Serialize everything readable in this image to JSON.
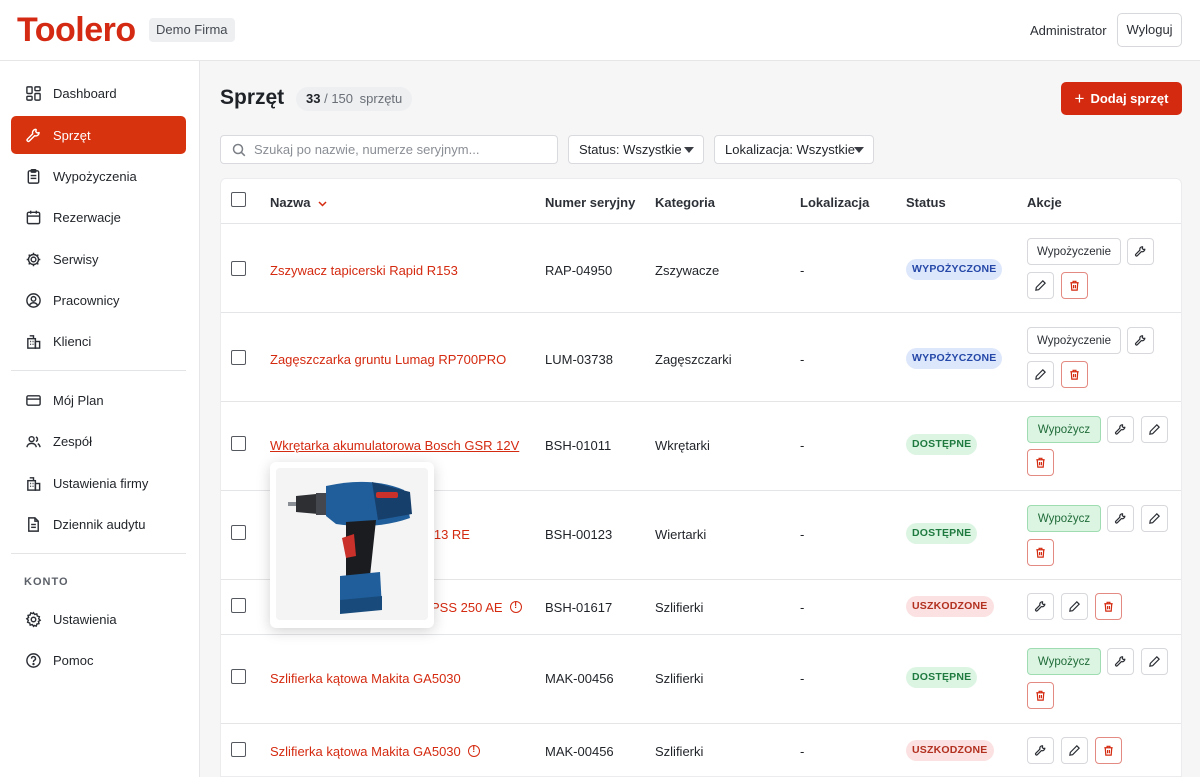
{
  "app": {
    "logo": "Toolero",
    "company": "Demo Firma",
    "user": "Administrator",
    "logout_label": "Wyloguj"
  },
  "sidebar": {
    "items": [
      {
        "label": "Dashboard",
        "icon": "dashboard-icon"
      },
      {
        "label": "Sprzęt",
        "icon": "wrench-icon",
        "active": true
      },
      {
        "label": "Wypożyczenia",
        "icon": "clipboard-icon"
      },
      {
        "label": "Rezerwacje",
        "icon": "calendar-icon"
      },
      {
        "label": "Serwisy",
        "icon": "cog-icon"
      },
      {
        "label": "Pracownicy",
        "icon": "user-circle-icon"
      },
      {
        "label": "Klienci",
        "icon": "building-icon"
      }
    ],
    "items2": [
      {
        "label": "Mój Plan",
        "icon": "credit-card-icon"
      },
      {
        "label": "Zespół",
        "icon": "users-icon"
      },
      {
        "label": "Ustawienia firmy",
        "icon": "building-icon"
      },
      {
        "label": "Dziennik audytu",
        "icon": "document-icon"
      }
    ],
    "section_label": "KONTO",
    "items3": [
      {
        "label": "Ustawienia",
        "icon": "settings-icon"
      },
      {
        "label": "Pomoc",
        "icon": "help-icon"
      }
    ]
  },
  "page": {
    "title": "Sprzęt",
    "count_shown": "33",
    "count_sep": "/ 150",
    "count_unit": "sprzętu",
    "add_label": "Dodaj sprzęt",
    "search_placeholder": "Szukaj po nazwie, numerze seryjnym...",
    "status_filter": "Status: Wszystkie",
    "location_filter": "Lokalizacja: Wszystkie"
  },
  "table": {
    "columns": [
      "Nazwa",
      "Numer seryjny",
      "Kategoria",
      "Lokalizacja",
      "Status",
      "Akcje"
    ],
    "rows": [
      {
        "name": "Zszywacz tapicerski Rapid R153",
        "serial": "RAP-04950",
        "category": "Zszywacze",
        "location": "-",
        "status": "WYPOŻYCZONE"
      },
      {
        "name": "Zagęszczarka gruntu Lumag RP700PRO",
        "serial": "LUM-03738",
        "category": "Zagęszczarki",
        "location": "-",
        "status": "WYPOŻYCZONE"
      },
      {
        "name": "Wkrętarka akumulatorowa Bosch GSR 12V",
        "serial": "BSH-01011",
        "category": "Wkrętarki",
        "location": "-",
        "status": "DOSTĘPNE"
      },
      {
        "name": "3 13 RE",
        "serial": "BSH-00123",
        "category": "Wiertarki",
        "location": "-",
        "status": "DOSTĘPNE"
      },
      {
        "name": "PSS 250 AE",
        "serial": "BSH-01617",
        "category": "Szlifierki",
        "location": "-",
        "status": "USZKODZONE"
      },
      {
        "name": "Szlifierka kątowa Makita GA5030",
        "serial": "MAK-00456",
        "category": "Szlifierki",
        "location": "-",
        "status": "DOSTĘPNE"
      },
      {
        "name": "Szlifierka kątowa Makita GA5030",
        "serial": "MAK-00456",
        "category": "Szlifierki",
        "location": "-",
        "status": "USZKODZONE"
      }
    ],
    "rent_out_label": "Wypożyczenie",
    "rent_label": "Wypożycz"
  },
  "colors": {
    "brand": "#d42a10",
    "rented_bg": "#dde7fb",
    "available_bg": "#dcf5e3",
    "damaged_bg": "#fbe1e1"
  }
}
